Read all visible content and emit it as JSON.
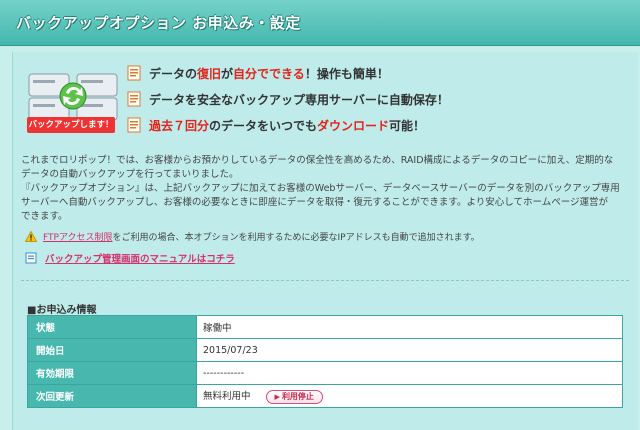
{
  "header": {
    "title": "バックアップオプション お申込み・設定"
  },
  "hero": {
    "caption": "バックアップします！",
    "features": [
      {
        "pre": "データの",
        "hl1": "復旧",
        "mid": "が",
        "hl2": "自分でできる",
        "post": "！操作も簡単！"
      },
      {
        "pre": "データを安全なバックアップ専用サーバーに自動保存！"
      },
      {
        "hl1": "過去７回分",
        "mid": "のデータをいつでも",
        "hl2": "ダウンロード",
        "post": "可能！"
      }
    ]
  },
  "description": {
    "line1": "これまでロリポップ！では、お客様からお預かりしているデータの保全性を高めるため、RAID構成によるデータのコピーに加え、定期的な",
    "line2": "データの自動バックアップを行ってまいりました。",
    "line3": "『バックアップオプション』は、上記バックアップに加えてお客様のWebサーバー、データベースサーバーのデータを別のバックアップ専用",
    "line4": "サーバーへ自動バックアップし、お客様の必要なときに即座にデータを取得・復元することができます。より安心してホームページ運営が",
    "line5": "できます。"
  },
  "note": {
    "link": "FTPアクセス制限",
    "text": "をご利用の場合、本オプションを利用するために必要なIPアドレスも自動で追加されます。"
  },
  "manual": {
    "link": "バックアップ管理画面のマニュアルはコチラ"
  },
  "application": {
    "title": "■お申込み情報",
    "rows": [
      {
        "label": "状態",
        "value": "稼働中"
      },
      {
        "label": "開始日",
        "value": "2015/07/23"
      },
      {
        "label": "有効期限",
        "value": "------------"
      },
      {
        "label": "次回更新",
        "value": "無料利用中"
      }
    ],
    "stop_button": "利用停止"
  },
  "colors": {
    "header": "#44b7ad",
    "accent": "#e2231a",
    "link": "#d62f6c",
    "table_header": "#48b8ae"
  }
}
